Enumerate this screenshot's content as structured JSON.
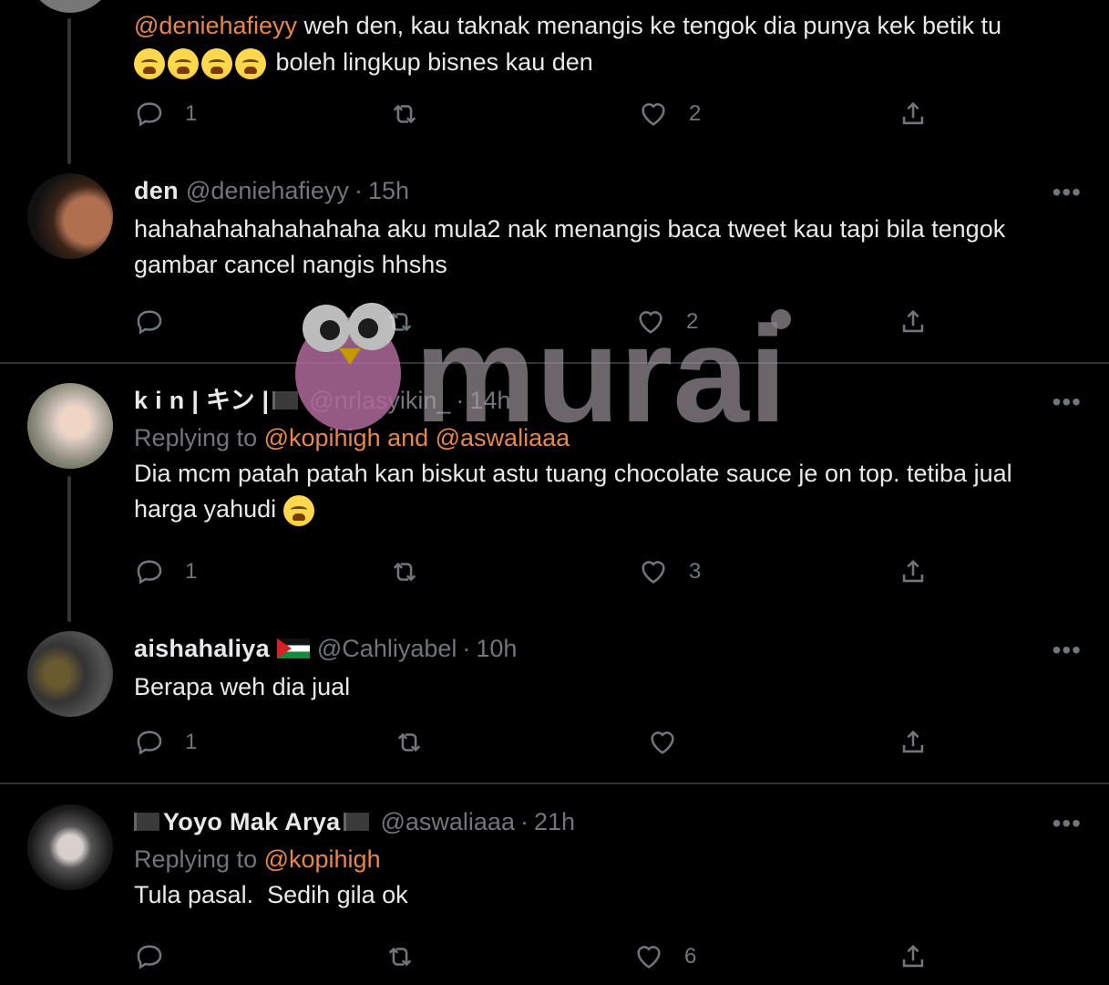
{
  "tweets": [
    {
      "body_mention": "@deniehafieyy",
      "body_text": " weh den, kau taknak menangis ke tengok dia punya kek betik tu",
      "body_line2": " boleh lingkup bisnes kau den",
      "replies": "1",
      "likes": "2"
    },
    {
      "name": "den",
      "handle": "@deniehafieyy",
      "time": "15h",
      "body_text": "hahahahahahahahaha aku mula2 nak menangis baca tweet kau tapi bila tengok gambar cancel nangis hhshs",
      "replies": "",
      "likes": "2"
    },
    {
      "name": "k i n | キン |",
      "handle": "@nrlasyikin_",
      "time": "14h",
      "replying_label": "Replying to ",
      "replying_to": "@kopihigh and @aswaliaaa",
      "body_text": "Dia mcm patah patah kan biskut astu tuang chocolate sauce je on top. tetiba jual harga yahudi ",
      "replies": "1",
      "likes": "3"
    },
    {
      "name": "aishahaliya",
      "handle": "@Cahliyabel",
      "time": "10h",
      "body_text": "Berapa weh dia jual",
      "replies": "1",
      "likes": ""
    },
    {
      "name": "Yoyo Mak Arya",
      "handle": "@aswaliaaa",
      "time": "21h",
      "replying_label": "Replying to ",
      "replying_to": "@kopihigh",
      "body_text": "Tula pasal.  Sedih gila ok",
      "replies": "",
      "likes": "6"
    }
  ],
  "dot": "·",
  "more": "•••",
  "watermark": {
    "text": "murai"
  },
  "colors": {
    "background": "#000000",
    "text": "#e7e9ea",
    "muted": "#71767b",
    "mention": "#e8874a",
    "divider": "#2f3336"
  }
}
